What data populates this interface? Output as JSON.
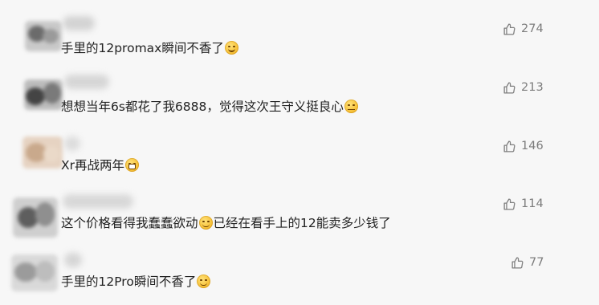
{
  "comments": [
    {
      "username": "",
      "text_before": "手里的12promax瞬间不香了",
      "emoji": "grinning-sweat",
      "text_after": "",
      "likes": "274"
    },
    {
      "username": "",
      "text_before": "想想当年6s都花了我6888，觉得这次王守义挺良心",
      "emoji": "thinking-face",
      "text_after": "",
      "likes": "213"
    },
    {
      "username": "",
      "text_before": "Xr再战两年",
      "emoji": "grinning-face",
      "text_after": "",
      "likes": "146"
    },
    {
      "username": "",
      "text_before": "这个价格看得我蠢蠢欲动",
      "emoji": "smirk-face",
      "text_after": "已经在看手上的12能卖多少钱了",
      "likes": "114"
    },
    {
      "username": "",
      "text_before": "手里的12Pro瞬间不香了",
      "emoji": "smirk-face",
      "text_after": "",
      "likes": "77"
    }
  ],
  "colors": {
    "background": "#f7f7f7",
    "text": "#222222",
    "like_text": "#7d7d7d"
  },
  "icons": {
    "like": "thumbs-up-icon"
  }
}
